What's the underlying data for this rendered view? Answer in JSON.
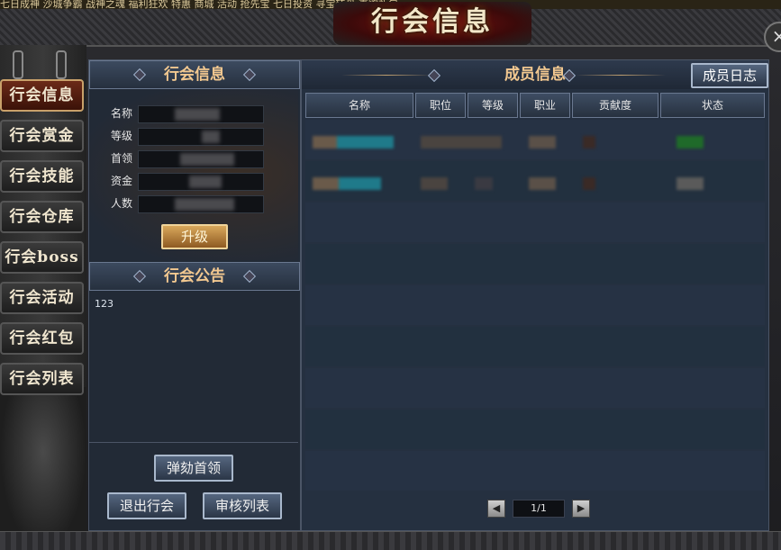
{
  "top_banner": "七日成神  沙城争霸  战神之魂  福利狂欢  特惠  商城  活动  抢先宝  七日投资  寻宝转盘  直购礼包",
  "window": {
    "title": "行会信息",
    "close_label": "×"
  },
  "tabs": [
    {
      "label": "行会信息",
      "active": true
    },
    {
      "label": "行会赏金",
      "active": false
    },
    {
      "label": "行会技能",
      "active": false
    },
    {
      "label": "行会仓库",
      "active": false
    },
    {
      "label": "行会boss",
      "active": false
    },
    {
      "label": "行会活动",
      "active": false
    },
    {
      "label": "行会红包",
      "active": false
    },
    {
      "label": "行会列表",
      "active": false
    }
  ],
  "guild_info": {
    "section_title": "行会信息",
    "fields": [
      {
        "label": "名称"
      },
      {
        "label": "等级"
      },
      {
        "label": "首领"
      },
      {
        "label": "资金"
      },
      {
        "label": "人数"
      }
    ],
    "upgrade_button": "升级"
  },
  "notice": {
    "section_title": "行会公告",
    "text": "123"
  },
  "left_buttons": {
    "impeach": "弹劾首领",
    "quit": "退出行会",
    "review": "审核列表"
  },
  "members": {
    "section_title": "成员信息",
    "log_button": "成员日志",
    "columns": [
      "名称",
      "职位",
      "等级",
      "职业",
      "贡献度",
      "状态"
    ],
    "rows": [
      {
        "status_color": "#1f6a2a"
      },
      {
        "status_color": "#5a5a5a"
      }
    ],
    "page": "1/1",
    "prev_arrow": "◀",
    "next_arrow": "▶"
  }
}
